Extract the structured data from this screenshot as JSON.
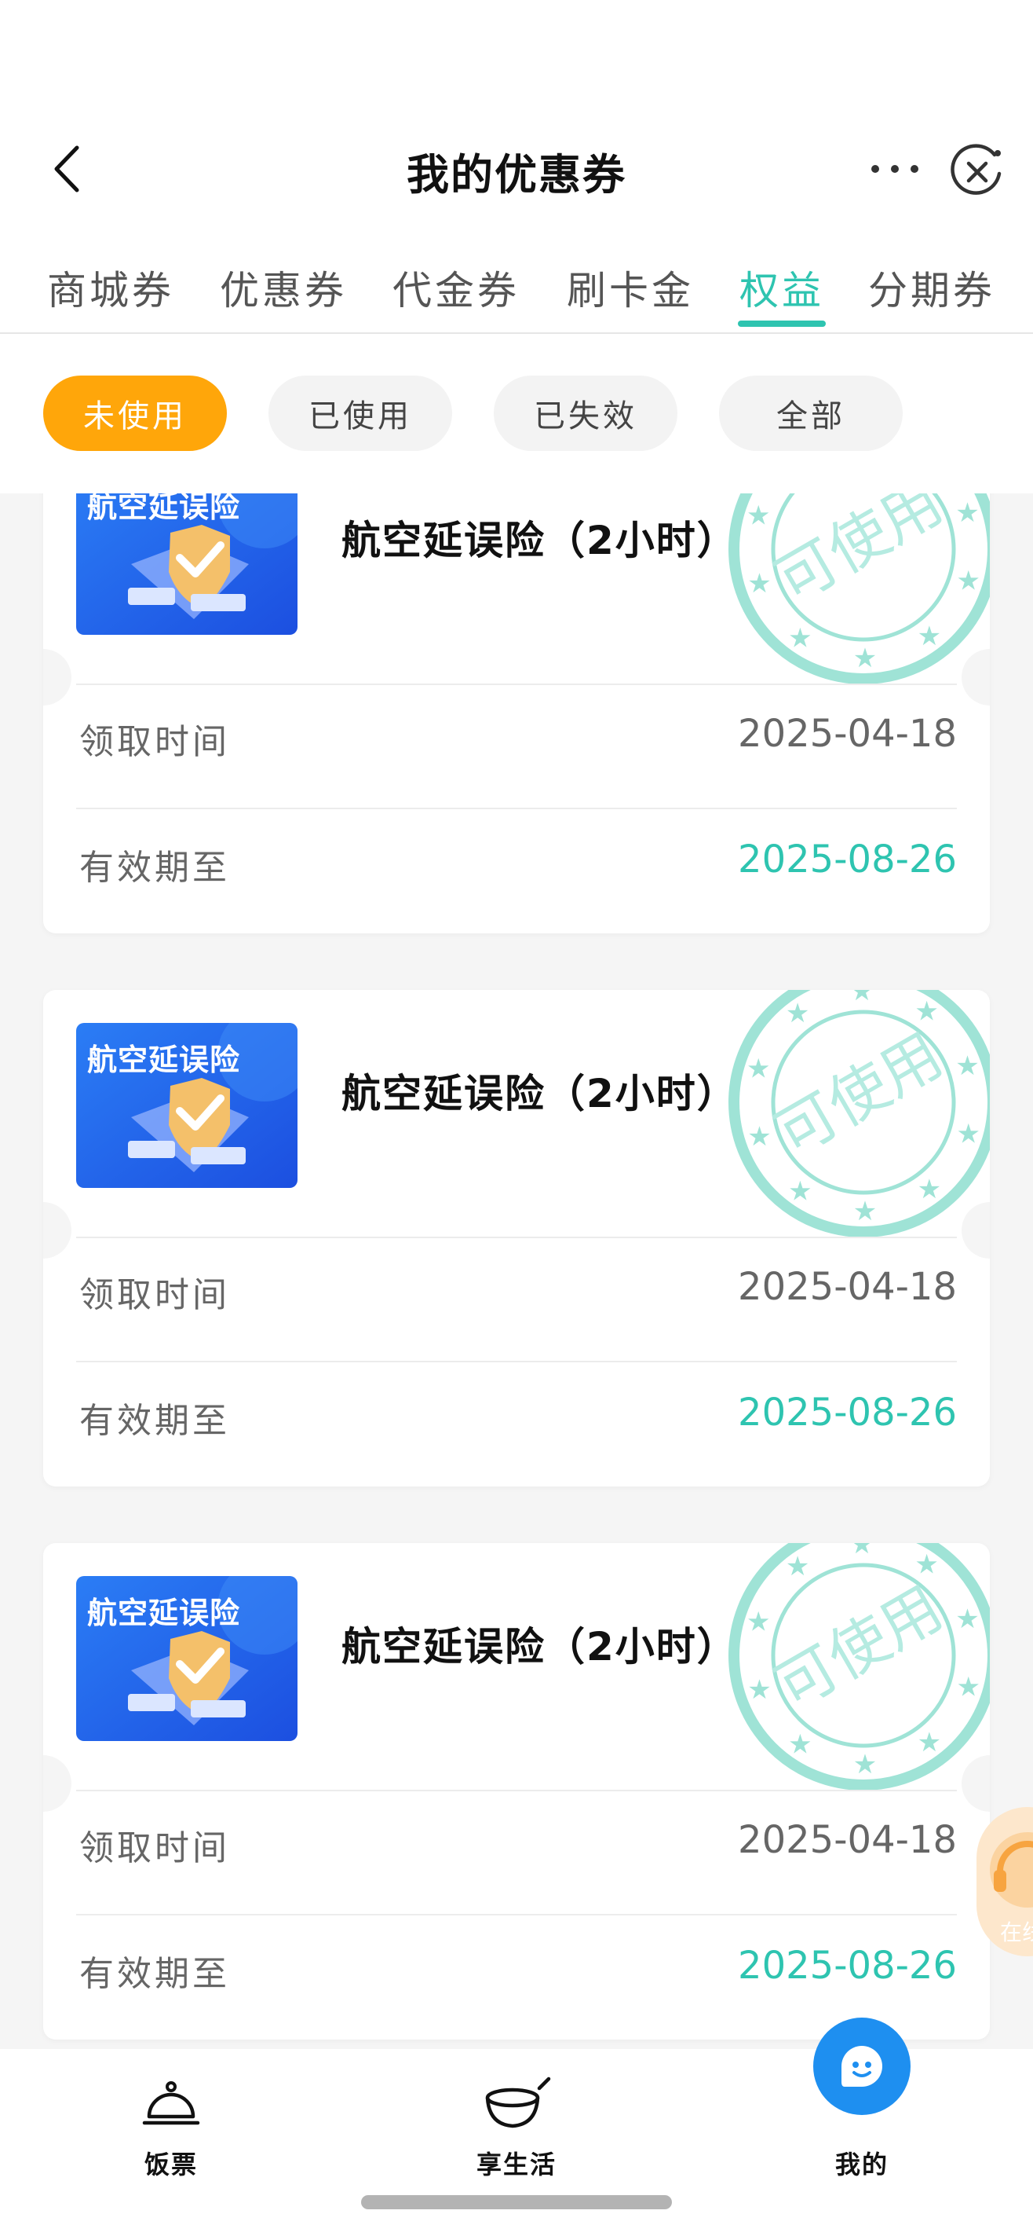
{
  "header": {
    "title": "我的优惠券"
  },
  "tabs": [
    {
      "label": "商城券"
    },
    {
      "label": "优惠券"
    },
    {
      "label": "代金券"
    },
    {
      "label": "刷卡金"
    },
    {
      "label": "权益",
      "active": true
    },
    {
      "label": "分期券"
    }
  ],
  "filters": [
    {
      "label": "未使用",
      "active": true
    },
    {
      "label": "已使用"
    },
    {
      "label": "已失效"
    },
    {
      "label": "全部"
    }
  ],
  "coupon_image_text": "航空延误险",
  "stamp_text": "可使用",
  "coupons": [
    {
      "name": "航空延误险（2小时）",
      "received_label": "领取时间",
      "received_date": "2025-04-18",
      "valid_label": "有效期至",
      "valid_date": "2025-08-26"
    },
    {
      "name": "航空延误险（2小时）",
      "received_label": "领取时间",
      "received_date": "2025-04-18",
      "valid_label": "有效期至",
      "valid_date": "2025-08-26"
    },
    {
      "name": "航空延误险（2小时）",
      "received_label": "领取时间",
      "received_date": "2025-04-18",
      "valid_label": "有效期至",
      "valid_date": "2025-08-26"
    }
  ],
  "float_button": {
    "label": "在线"
  },
  "bottom_nav": [
    {
      "label": "饭票",
      "icon": "food-cover-icon"
    },
    {
      "label": "享生活",
      "icon": "bowl-icon"
    },
    {
      "label": "我的",
      "icon": "smile-face-icon",
      "active": true
    }
  ],
  "colors": {
    "accent": "#2ec4b0",
    "filter_active": "#ffa60a",
    "mine_bubble": "#1e8ff0"
  }
}
